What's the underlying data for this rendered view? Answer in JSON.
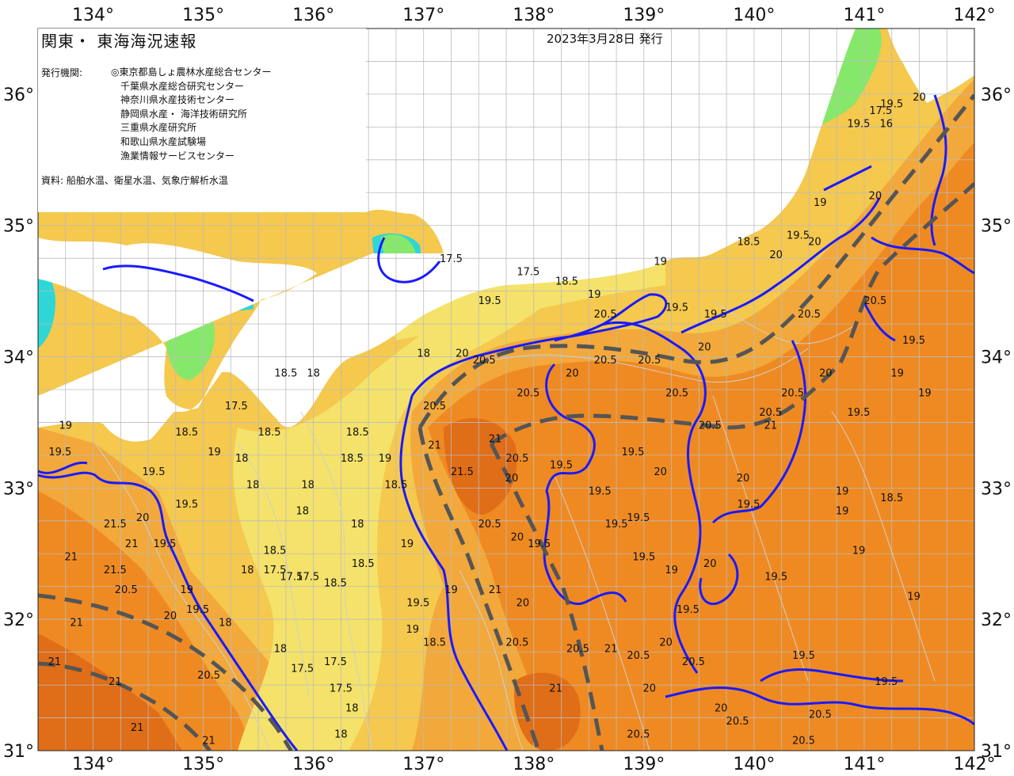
{
  "title": "関東・ 東海海況速報",
  "issued": "2023年3月28日 発行",
  "issuer_label": "発行機関:",
  "issuers": [
    "◎東京都島しょ農林水産総合センター",
    "千葉県水産総合研究センター",
    "神奈川県水産技術センター",
    "静岡県水産・ 海洋技術研究所",
    "三重県水産研究所",
    "和歌山県水産試験場",
    "漁業情報サービスセンター"
  ],
  "sources": "資料: 船舶水温、衛星水温、気象庁解析水温",
  "axes": {
    "longitude_labels": [
      "134°",
      "135°",
      "136°",
      "137°",
      "138°",
      "139°",
      "140°",
      "141°",
      "142°"
    ],
    "latitude_labels": [
      "36°",
      "35°",
      "34°",
      "33°",
      "32°",
      "31°"
    ],
    "lon_range": [
      133.5,
      142.0
    ],
    "lat_range": [
      31.0,
      36.5
    ]
  },
  "colors": {
    "land": "#ffffff",
    "t_lt16": "#2fd6d6",
    "t_16_17": "#86e86b",
    "t_17_18": "#f4e26a",
    "t_18_19": "#f5c84e",
    "t_19_20": "#f2a83a",
    "t_20_21": "#ef8a22",
    "t_ge21": "#e06d18",
    "isotherm_major": "#1a1aff",
    "front_line": "#555555",
    "grid": "#bbbbbb"
  },
  "isotherm_labels": [
    {
      "text": "17.5",
      "lon": 137.25,
      "lat": 34.72
    },
    {
      "text": "17.5",
      "lon": 137.95,
      "lat": 34.62
    },
    {
      "text": "18.5",
      "lon": 138.3,
      "lat": 34.55
    },
    {
      "text": "19.5",
      "lon": 137.6,
      "lat": 34.4
    },
    {
      "text": "19",
      "lon": 138.55,
      "lat": 34.45
    },
    {
      "text": "20.5",
      "lon": 138.65,
      "lat": 34.3
    },
    {
      "text": "19.5",
      "lon": 139.3,
      "lat": 34.35
    },
    {
      "text": "19.5",
      "lon": 139.65,
      "lat": 34.3
    },
    {
      "text": "19",
      "lon": 139.15,
      "lat": 34.7
    },
    {
      "text": "18.5",
      "lon": 139.95,
      "lat": 34.85
    },
    {
      "text": "19.5",
      "lon": 140.4,
      "lat": 34.9
    },
    {
      "text": "20",
      "lon": 140.2,
      "lat": 34.75
    },
    {
      "text": "19",
      "lon": 140.6,
      "lat": 35.15
    },
    {
      "text": "20",
      "lon": 141.1,
      "lat": 35.2
    },
    {
      "text": "20",
      "lon": 140.55,
      "lat": 34.85
    },
    {
      "text": "20.5",
      "lon": 140.5,
      "lat": 34.3
    },
    {
      "text": "20.5",
      "lon": 141.1,
      "lat": 34.4
    },
    {
      "text": "19.5",
      "lon": 141.45,
      "lat": 34.1
    },
    {
      "text": "20",
      "lon": 140.65,
      "lat": 33.85
    },
    {
      "text": "19",
      "lon": 141.3,
      "lat": 33.85
    },
    {
      "text": "20.5",
      "lon": 140.35,
      "lat": 33.7
    },
    {
      "text": "19.5",
      "lon": 140.95,
      "lat": 33.55
    },
    {
      "text": "20.5",
      "lon": 140.15,
      "lat": 33.55
    },
    {
      "text": "21",
      "lon": 140.15,
      "lat": 33.45
    },
    {
      "text": "20.5",
      "lon": 139.6,
      "lat": 33.45
    },
    {
      "text": "20.5",
      "lon": 139.3,
      "lat": 33.7
    },
    {
      "text": "20",
      "lon": 139.55,
      "lat": 34.05
    },
    {
      "text": "20.5",
      "lon": 139.05,
      "lat": 33.95
    },
    {
      "text": "20.5",
      "lon": 138.65,
      "lat": 33.95
    },
    {
      "text": "20",
      "lon": 138.35,
      "lat": 33.85
    },
    {
      "text": "20.5",
      "lon": 137.95,
      "lat": 33.7
    },
    {
      "text": "20.5",
      "lon": 137.55,
      "lat": 33.95
    },
    {
      "text": "20",
      "lon": 137.35,
      "lat": 34.0
    },
    {
      "text": "18",
      "lon": 137.0,
      "lat": 34.0
    },
    {
      "text": "20.5",
      "lon": 137.1,
      "lat": 33.6
    },
    {
      "text": "21",
      "lon": 137.1,
      "lat": 33.3
    },
    {
      "text": "21.5",
      "lon": 137.35,
      "lat": 33.1
    },
    {
      "text": "21",
      "lon": 137.65,
      "lat": 33.35
    },
    {
      "text": "20.5",
      "lon": 137.85,
      "lat": 33.2
    },
    {
      "text": "20",
      "lon": 137.8,
      "lat": 33.05
    },
    {
      "text": "19.5",
      "lon": 138.25,
      "lat": 33.15
    },
    {
      "text": "19.5",
      "lon": 138.9,
      "lat": 33.25
    },
    {
      "text": "20",
      "lon": 139.15,
      "lat": 33.1
    },
    {
      "text": "19.5",
      "lon": 138.6,
      "lat": 32.95
    },
    {
      "text": "19.5",
      "lon": 138.75,
      "lat": 32.7
    },
    {
      "text": "19.5",
      "lon": 138.95,
      "lat": 32.75
    },
    {
      "text": "19.5",
      "lon": 139.0,
      "lat": 32.45
    },
    {
      "text": "19",
      "lon": 139.25,
      "lat": 32.35
    },
    {
      "text": "19.5",
      "lon": 139.4,
      "lat": 32.05
    },
    {
      "text": "20",
      "lon": 139.2,
      "lat": 31.8
    },
    {
      "text": "20",
      "lon": 139.6,
      "lat": 32.4
    },
    {
      "text": "19.5",
      "lon": 139.95,
      "lat": 32.85
    },
    {
      "text": "19.5",
      "lon": 140.2,
      "lat": 32.3
    },
    {
      "text": "20",
      "lon": 139.9,
      "lat": 33.05
    },
    {
      "text": "19",
      "lon": 140.8,
      "lat": 32.95
    },
    {
      "text": "19",
      "lon": 140.8,
      "lat": 32.8
    },
    {
      "text": "18.5",
      "lon": 141.25,
      "lat": 32.9
    },
    {
      "text": "19",
      "lon": 140.95,
      "lat": 32.5
    },
    {
      "text": "19",
      "lon": 141.45,
      "lat": 32.15
    },
    {
      "text": "19.5",
      "lon": 140.45,
      "lat": 31.7
    },
    {
      "text": "19.5",
      "lon": 141.2,
      "lat": 31.5
    },
    {
      "text": "20.5",
      "lon": 140.6,
      "lat": 31.25
    },
    {
      "text": "20.5",
      "lon": 140.45,
      "lat": 31.05
    },
    {
      "text": "20.5",
      "lon": 139.85,
      "lat": 31.2
    },
    {
      "text": "20",
      "lon": 139.7,
      "lat": 31.3
    },
    {
      "text": "20.5",
      "lon": 139.45,
      "lat": 31.65
    },
    {
      "text": "20",
      "lon": 139.05,
      "lat": 31.45
    },
    {
      "text": "20.5",
      "lon": 138.95,
      "lat": 31.1
    },
    {
      "text": "20.5",
      "lon": 138.4,
      "lat": 31.75
    },
    {
      "text": "21",
      "lon": 138.7,
      "lat": 31.75
    },
    {
      "text": "20.5",
      "lon": 138.95,
      "lat": 31.7
    },
    {
      "text": "21",
      "lon": 138.2,
      "lat": 31.45
    },
    {
      "text": "20.5",
      "lon": 137.85,
      "lat": 31.8
    },
    {
      "text": "20",
      "lon": 137.9,
      "lat": 32.1
    },
    {
      "text": "21",
      "lon": 137.65,
      "lat": 32.2
    },
    {
      "text": "20.5",
      "lon": 137.6,
      "lat": 32.7
    },
    {
      "text": "20",
      "lon": 137.85,
      "lat": 32.6
    },
    {
      "text": "19.5",
      "lon": 138.05,
      "lat": 32.55
    },
    {
      "text": "19",
      "lon": 137.25,
      "lat": 32.2
    },
    {
      "text": "19",
      "lon": 136.9,
      "lat": 31.9
    },
    {
      "text": "18.5",
      "lon": 137.1,
      "lat": 31.8
    },
    {
      "text": "19.5",
      "lon": 136.95,
      "lat": 32.1
    },
    {
      "text": "19",
      "lon": 136.85,
      "lat": 32.55
    },
    {
      "text": "18.5",
      "lon": 136.75,
      "lat": 33.0
    },
    {
      "text": "19",
      "lon": 136.65,
      "lat": 33.2
    },
    {
      "text": "18.5",
      "lon": 136.35,
      "lat": 33.2
    },
    {
      "text": "18",
      "lon": 135.95,
      "lat": 33.0
    },
    {
      "text": "18",
      "lon": 136.4,
      "lat": 32.7
    },
    {
      "text": "18.5",
      "lon": 136.45,
      "lat": 32.4
    },
    {
      "text": "18.5",
      "lon": 136.2,
      "lat": 32.25
    },
    {
      "text": "17.5",
      "lon": 135.95,
      "lat": 32.3
    },
    {
      "text": "17.5",
      "lon": 135.65,
      "lat": 32.35
    },
    {
      "text": "17.5",
      "lon": 135.8,
      "lat": 32.3
    },
    {
      "text": "18.5",
      "lon": 135.65,
      "lat": 32.5
    },
    {
      "text": "18",
      "lon": 135.4,
      "lat": 32.35
    },
    {
      "text": "18",
      "lon": 135.2,
      "lat": 31.95
    },
    {
      "text": "18",
      "lon": 135.7,
      "lat": 31.75
    },
    {
      "text": "17.5",
      "lon": 135.9,
      "lat": 31.6
    },
    {
      "text": "17.5",
      "lon": 136.2,
      "lat": 31.65
    },
    {
      "text": "17.5",
      "lon": 136.25,
      "lat": 31.45
    },
    {
      "text": "18",
      "lon": 136.35,
      "lat": 31.3
    },
    {
      "text": "18",
      "lon": 136.25,
      "lat": 31.1
    },
    {
      "text": "18",
      "lon": 135.9,
      "lat": 32.8
    },
    {
      "text": "18",
      "lon": 135.45,
      "lat": 33.0
    },
    {
      "text": "18.5",
      "lon": 135.6,
      "lat": 33.4
    },
    {
      "text": "18",
      "lon": 135.35,
      "lat": 33.2
    },
    {
      "text": "19",
      "lon": 135.1,
      "lat": 33.25
    },
    {
      "text": "17.5",
      "lon": 135.3,
      "lat": 33.6
    },
    {
      "text": "18.5",
      "lon": 135.75,
      "lat": 33.85
    },
    {
      "text": "18",
      "lon": 136.0,
      "lat": 33.85
    },
    {
      "text": "18.5",
      "lon": 136.4,
      "lat": 33.4
    },
    {
      "text": "18.5",
      "lon": 134.85,
      "lat": 33.4
    },
    {
      "text": "19.5",
      "lon": 134.55,
      "lat": 33.1
    },
    {
      "text": "19.5",
      "lon": 134.85,
      "lat": 32.85
    },
    {
      "text": "19.5",
      "lon": 134.65,
      "lat": 32.55
    },
    {
      "text": "20",
      "lon": 134.45,
      "lat": 32.75
    },
    {
      "text": "21",
      "lon": 134.35,
      "lat": 32.55
    },
    {
      "text": "21.5",
      "lon": 134.2,
      "lat": 32.7
    },
    {
      "text": "21",
      "lon": 133.8,
      "lat": 32.45
    },
    {
      "text": "21.5",
      "lon": 134.2,
      "lat": 32.35
    },
    {
      "text": "20.5",
      "lon": 134.3,
      "lat": 32.2
    },
    {
      "text": "19",
      "lon": 134.85,
      "lat": 32.2
    },
    {
      "text": "19.5",
      "lon": 134.95,
      "lat": 32.05
    },
    {
      "text": "20",
      "lon": 134.7,
      "lat": 32.0
    },
    {
      "text": "21",
      "lon": 133.85,
      "lat": 31.95
    },
    {
      "text": "21",
      "lon": 133.65,
      "lat": 31.65
    },
    {
      "text": "21",
      "lon": 134.2,
      "lat": 31.5
    },
    {
      "text": "21",
      "lon": 134.4,
      "lat": 31.15
    },
    {
      "text": "20.5",
      "lon": 135.05,
      "lat": 31.55
    },
    {
      "text": "21",
      "lon": 135.05,
      "lat": 31.05
    },
    {
      "text": "19.5",
      "lon": 133.7,
      "lat": 33.25
    },
    {
      "text": "19",
      "lon": 133.75,
      "lat": 33.45
    },
    {
      "text": "19.5",
      "lon": 140.95,
      "lat": 35.75
    },
    {
      "text": "16",
      "lon": 141.2,
      "lat": 35.75
    },
    {
      "text": "17.5",
      "lon": 141.15,
      "lat": 35.85
    },
    {
      "text": "19.5",
      "lon": 141.25,
      "lat": 35.9
    },
    {
      "text": "20",
      "lon": 141.5,
      "lat": 35.95
    },
    {
      "text": "19",
      "lon": 141.55,
      "lat": 33.7
    }
  ]
}
